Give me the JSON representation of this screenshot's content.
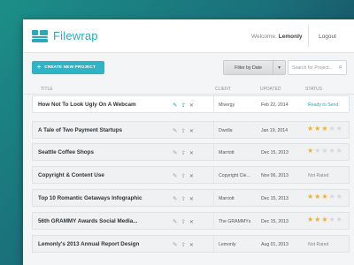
{
  "app": {
    "name": "Filewrap",
    "welcome_prefix": "Welcome,",
    "username": "Lemonly",
    "logout_label": "Logout"
  },
  "toolbar": {
    "create_label": "CREATE NEW PROJECT",
    "filter_label": "Filter by Date",
    "search_placeholder": "Search for Project..."
  },
  "columns": {
    "title": "TITLE",
    "client": "CLIENT",
    "updated": "UPDATED",
    "status": "STATUS"
  },
  "projects": [
    {
      "title": "How Not To Look Ugly  On A Webcam",
      "client": "Mivergy",
      "updated": "Feb 22, 2014",
      "status": "Ready to Send",
      "rating": null,
      "highlight": true
    },
    {
      "title": "A Tale of Two Payment Startups",
      "client": "Dwolla",
      "updated": "Jan 19, 2014",
      "status": "",
      "rating": 3,
      "highlight": false
    },
    {
      "title": "Seattle Coffee Shops",
      "client": "Marriott",
      "updated": "Dec 15, 2013",
      "status": "",
      "rating": 1,
      "highlight": false
    },
    {
      "title": "Copyright & Content Use",
      "client": "Copyright Cle...",
      "updated": "Nov 06, 2013",
      "status": "Not Rated",
      "rating": null,
      "highlight": false
    },
    {
      "title": "Top 10 Romantic Getaways Infographic",
      "client": "Marriott",
      "updated": "Dec 15, 2013",
      "status": "",
      "rating": 3,
      "highlight": false
    },
    {
      "title": "56th GRAMMY Awards Social Media...",
      "client": "The GRAMMYs",
      "updated": "Dec 15, 2013",
      "status": "",
      "rating": 3,
      "highlight": false
    },
    {
      "title": "Lemonly's 2013 Annual Report Design",
      "client": "Lemonly",
      "updated": "Aug 01, 2013",
      "status": "Not Rated",
      "rating": null,
      "highlight": false
    }
  ],
  "colors": {
    "accent": "#2aa9bd",
    "star": "#f2b11e"
  }
}
